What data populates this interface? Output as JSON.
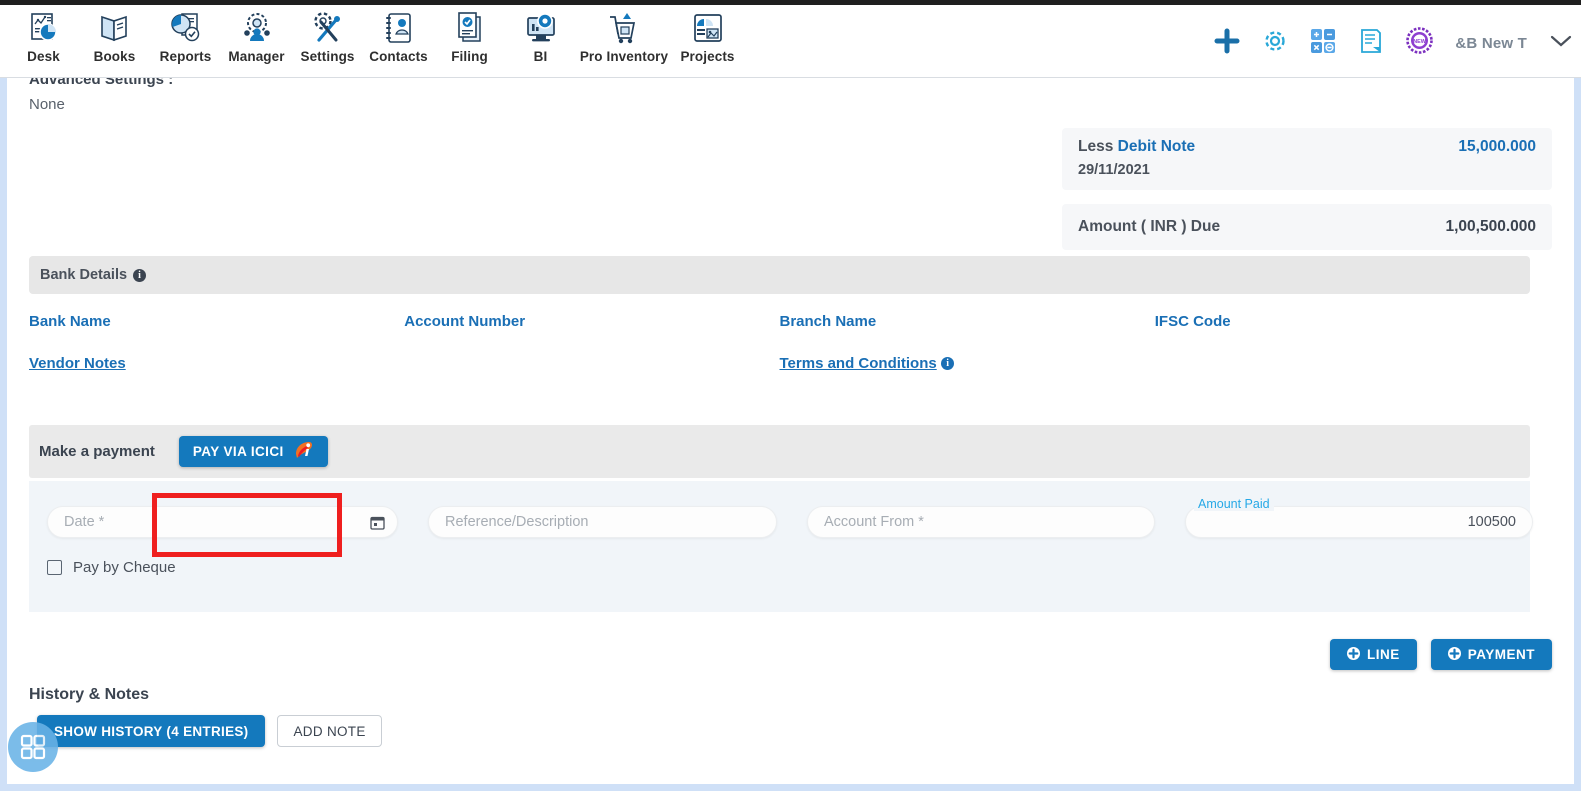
{
  "nav": {
    "items": [
      {
        "label": "Desk",
        "icon": "desk-icon"
      },
      {
        "label": "Books",
        "icon": "books-icon"
      },
      {
        "label": "Reports",
        "icon": "reports-icon"
      },
      {
        "label": "Manager",
        "icon": "manager-icon"
      },
      {
        "label": "Settings",
        "icon": "settings-icon"
      },
      {
        "label": "Contacts",
        "icon": "contacts-icon"
      },
      {
        "label": "Filing",
        "icon": "filing-icon"
      },
      {
        "label": "BI",
        "icon": "bi-icon"
      },
      {
        "label": "Pro Inventory",
        "icon": "pro-inventory-icon"
      },
      {
        "label": "Projects",
        "icon": "projects-icon"
      }
    ],
    "right": {
      "add_icon": "plus-icon",
      "settings_icon": "gear-icon",
      "calculator_icon": "calculator-icon",
      "notes_icon": "notes-icon",
      "new_badge_icon": "new-badge-icon",
      "user": "&B New T",
      "chevron_icon": "chevron-down-icon"
    }
  },
  "advanced": {
    "title": "Advanced Settings :",
    "value": "None"
  },
  "totals": {
    "debit_note": {
      "prefix": "Less",
      "link": "Debit Note",
      "date": "29/11/2021",
      "amount": "15,000.000"
    },
    "amount_due": {
      "label": "Amount ( INR ) Due",
      "amount": "1,00,500.000"
    }
  },
  "bank_details": {
    "section_title": "Bank Details",
    "info_icon": "info-icon",
    "fields": [
      {
        "label": "Bank Name"
      },
      {
        "label": "Account Number"
      },
      {
        "label": "Branch Name"
      },
      {
        "label": "IFSC Code"
      }
    ],
    "vendor_notes": "Vendor Notes",
    "terms_and_conditions": "Terms and Conditions"
  },
  "payment": {
    "make_a_payment_label": "Make a payment",
    "pay_button_label": "PAY VIA ICICI",
    "pay_button_icon": "icici-logo-icon",
    "highlight_color": "#ef1f1f",
    "fields": {
      "date_placeholder": "Date *",
      "date_value": "",
      "calendar_icon": "calendar-icon",
      "reference_placeholder": "Reference/Description",
      "reference_value": "",
      "account_from_placeholder": "Account From *",
      "account_from_value": "",
      "amount_paid_label": "Amount Paid",
      "amount_paid_value": "100500"
    },
    "pay_by_cheque_label": "Pay by Cheque",
    "pay_by_cheque_checked": false
  },
  "actions": {
    "line_label": "LINE",
    "payment_label": "PAYMENT",
    "plus_icon": "plus-circle-icon"
  },
  "history": {
    "title": "History & Notes",
    "show_history_label": "SHOW HISTORY (4 ENTRIES)",
    "add_note_label": "ADD NOTE"
  },
  "fab": {
    "icon": "grid-widget-icon"
  },
  "colors": {
    "accent_blue": "#1479bd",
    "link_blue": "#1a6fb5",
    "highlight_red": "#ef1f1f",
    "panel_bg": "#f1f5f9",
    "bar_bg": "#e7e7e7",
    "page_border": "#cfe0f7"
  }
}
